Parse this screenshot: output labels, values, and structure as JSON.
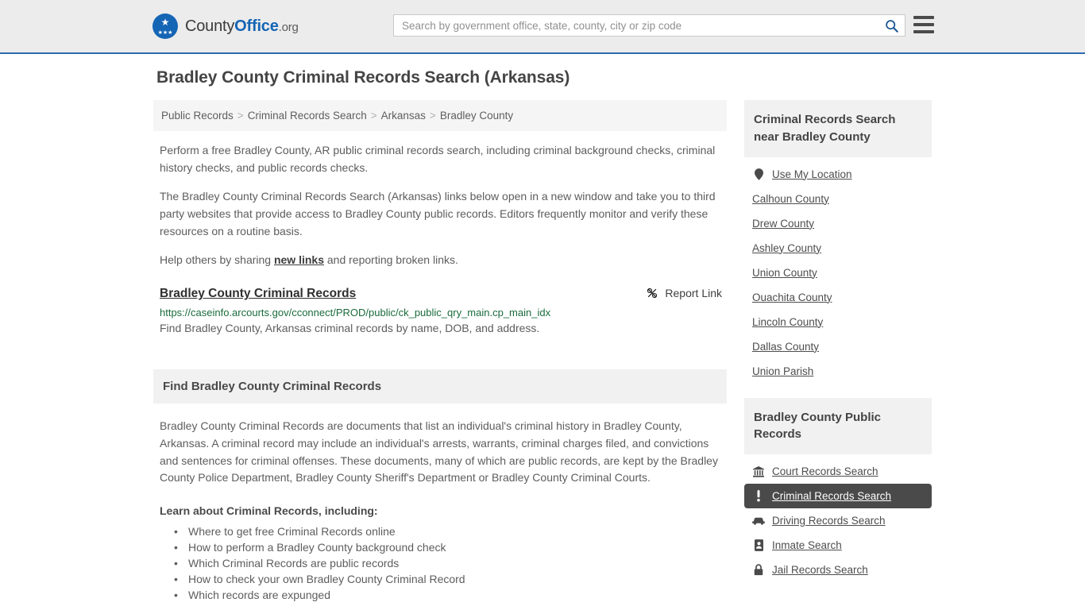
{
  "header": {
    "brand": {
      "part1": "County",
      "part2": "Office",
      "part3": ".org",
      "logo_icon": "eagle-shield-logo",
      "stars": "★★★"
    },
    "search": {
      "placeholder": "Search by government office, state, county, city or zip code",
      "value": "",
      "icon": "search-icon"
    },
    "menu_icon": "hamburger-menu-icon"
  },
  "page": {
    "title": "Bradley County Criminal Records Search (Arkansas)"
  },
  "breadcrumb": {
    "items": [
      "Public Records",
      "Criminal Records Search",
      "Arkansas",
      "Bradley County"
    ],
    "separator": ">"
  },
  "intro": {
    "p1": "Perform a free Bradley County, AR public criminal records search, including criminal background checks, criminal history checks, and public records checks.",
    "p2": "The Bradley County Criminal Records Search (Arkansas) links below open in a new window and take you to third party websites that provide access to Bradley County public records. Editors frequently monitor and verify these resources on a routine basis.",
    "p3_before": "Help others by sharing ",
    "p3_link": "new links",
    "p3_after": " and reporting broken links."
  },
  "result": {
    "title": "Bradley County Criminal Records",
    "url": "https://caseinfo.arcourts.gov/cconnect/PROD/public/ck_public_qry_main.cp_main_idx",
    "description": "Find Bradley County, Arkansas criminal records by name, DOB, and address.",
    "report_label": "Report Link",
    "report_icon": "broken-link-icon"
  },
  "section": {
    "heading": "Find Bradley County Criminal Records",
    "paragraph": "Bradley County Criminal Records are documents that list an individual's criminal history in Bradley County, Arkansas. A criminal record may include an individual's arrests, warrants, criminal charges filed, and convictions and sentences for criminal offenses. These documents, many of which are public records, are kept by the Bradley County Police Department, Bradley County Sheriff's Department or Bradley County Criminal Courts.",
    "learn_label": "Learn about Criminal Records, including:",
    "learn_items": [
      "Where to get free Criminal Records online",
      "How to perform a Bradley County background check",
      "Which Criminal Records are public records",
      "How to check your own Bradley County Criminal Record",
      "Which records are expunged"
    ]
  },
  "sidebar": {
    "nearby": {
      "heading": "Criminal Records Search near Bradley County",
      "items": [
        {
          "label": "Use My Location",
          "icon": "map-pin-icon"
        },
        {
          "label": "Calhoun County",
          "icon": ""
        },
        {
          "label": "Drew County",
          "icon": ""
        },
        {
          "label": "Ashley County",
          "icon": ""
        },
        {
          "label": "Union County",
          "icon": ""
        },
        {
          "label": "Ouachita County",
          "icon": ""
        },
        {
          "label": "Lincoln County",
          "icon": ""
        },
        {
          "label": "Dallas County",
          "icon": ""
        },
        {
          "label": "Union Parish",
          "icon": ""
        }
      ]
    },
    "public_records": {
      "heading": "Bradley County Public Records",
      "items": [
        {
          "label": "Court Records Search",
          "icon": "courthouse-icon",
          "active": false
        },
        {
          "label": "Criminal Records Search",
          "icon": "exclamation-icon",
          "active": true
        },
        {
          "label": "Driving Records Search",
          "icon": "car-icon",
          "active": false
        },
        {
          "label": "Inmate Search",
          "icon": "id-badge-icon",
          "active": false
        },
        {
          "label": "Jail Records Search",
          "icon": "lock-icon",
          "active": false
        }
      ]
    }
  },
  "colors": {
    "brand_blue": "#1565b5",
    "header_bg": "#ececec",
    "header_border": "#2b6cb0",
    "panel_bg": "#f1f1f1",
    "active_bg": "#4a4a4a",
    "url_green": "#1a6b3c"
  }
}
